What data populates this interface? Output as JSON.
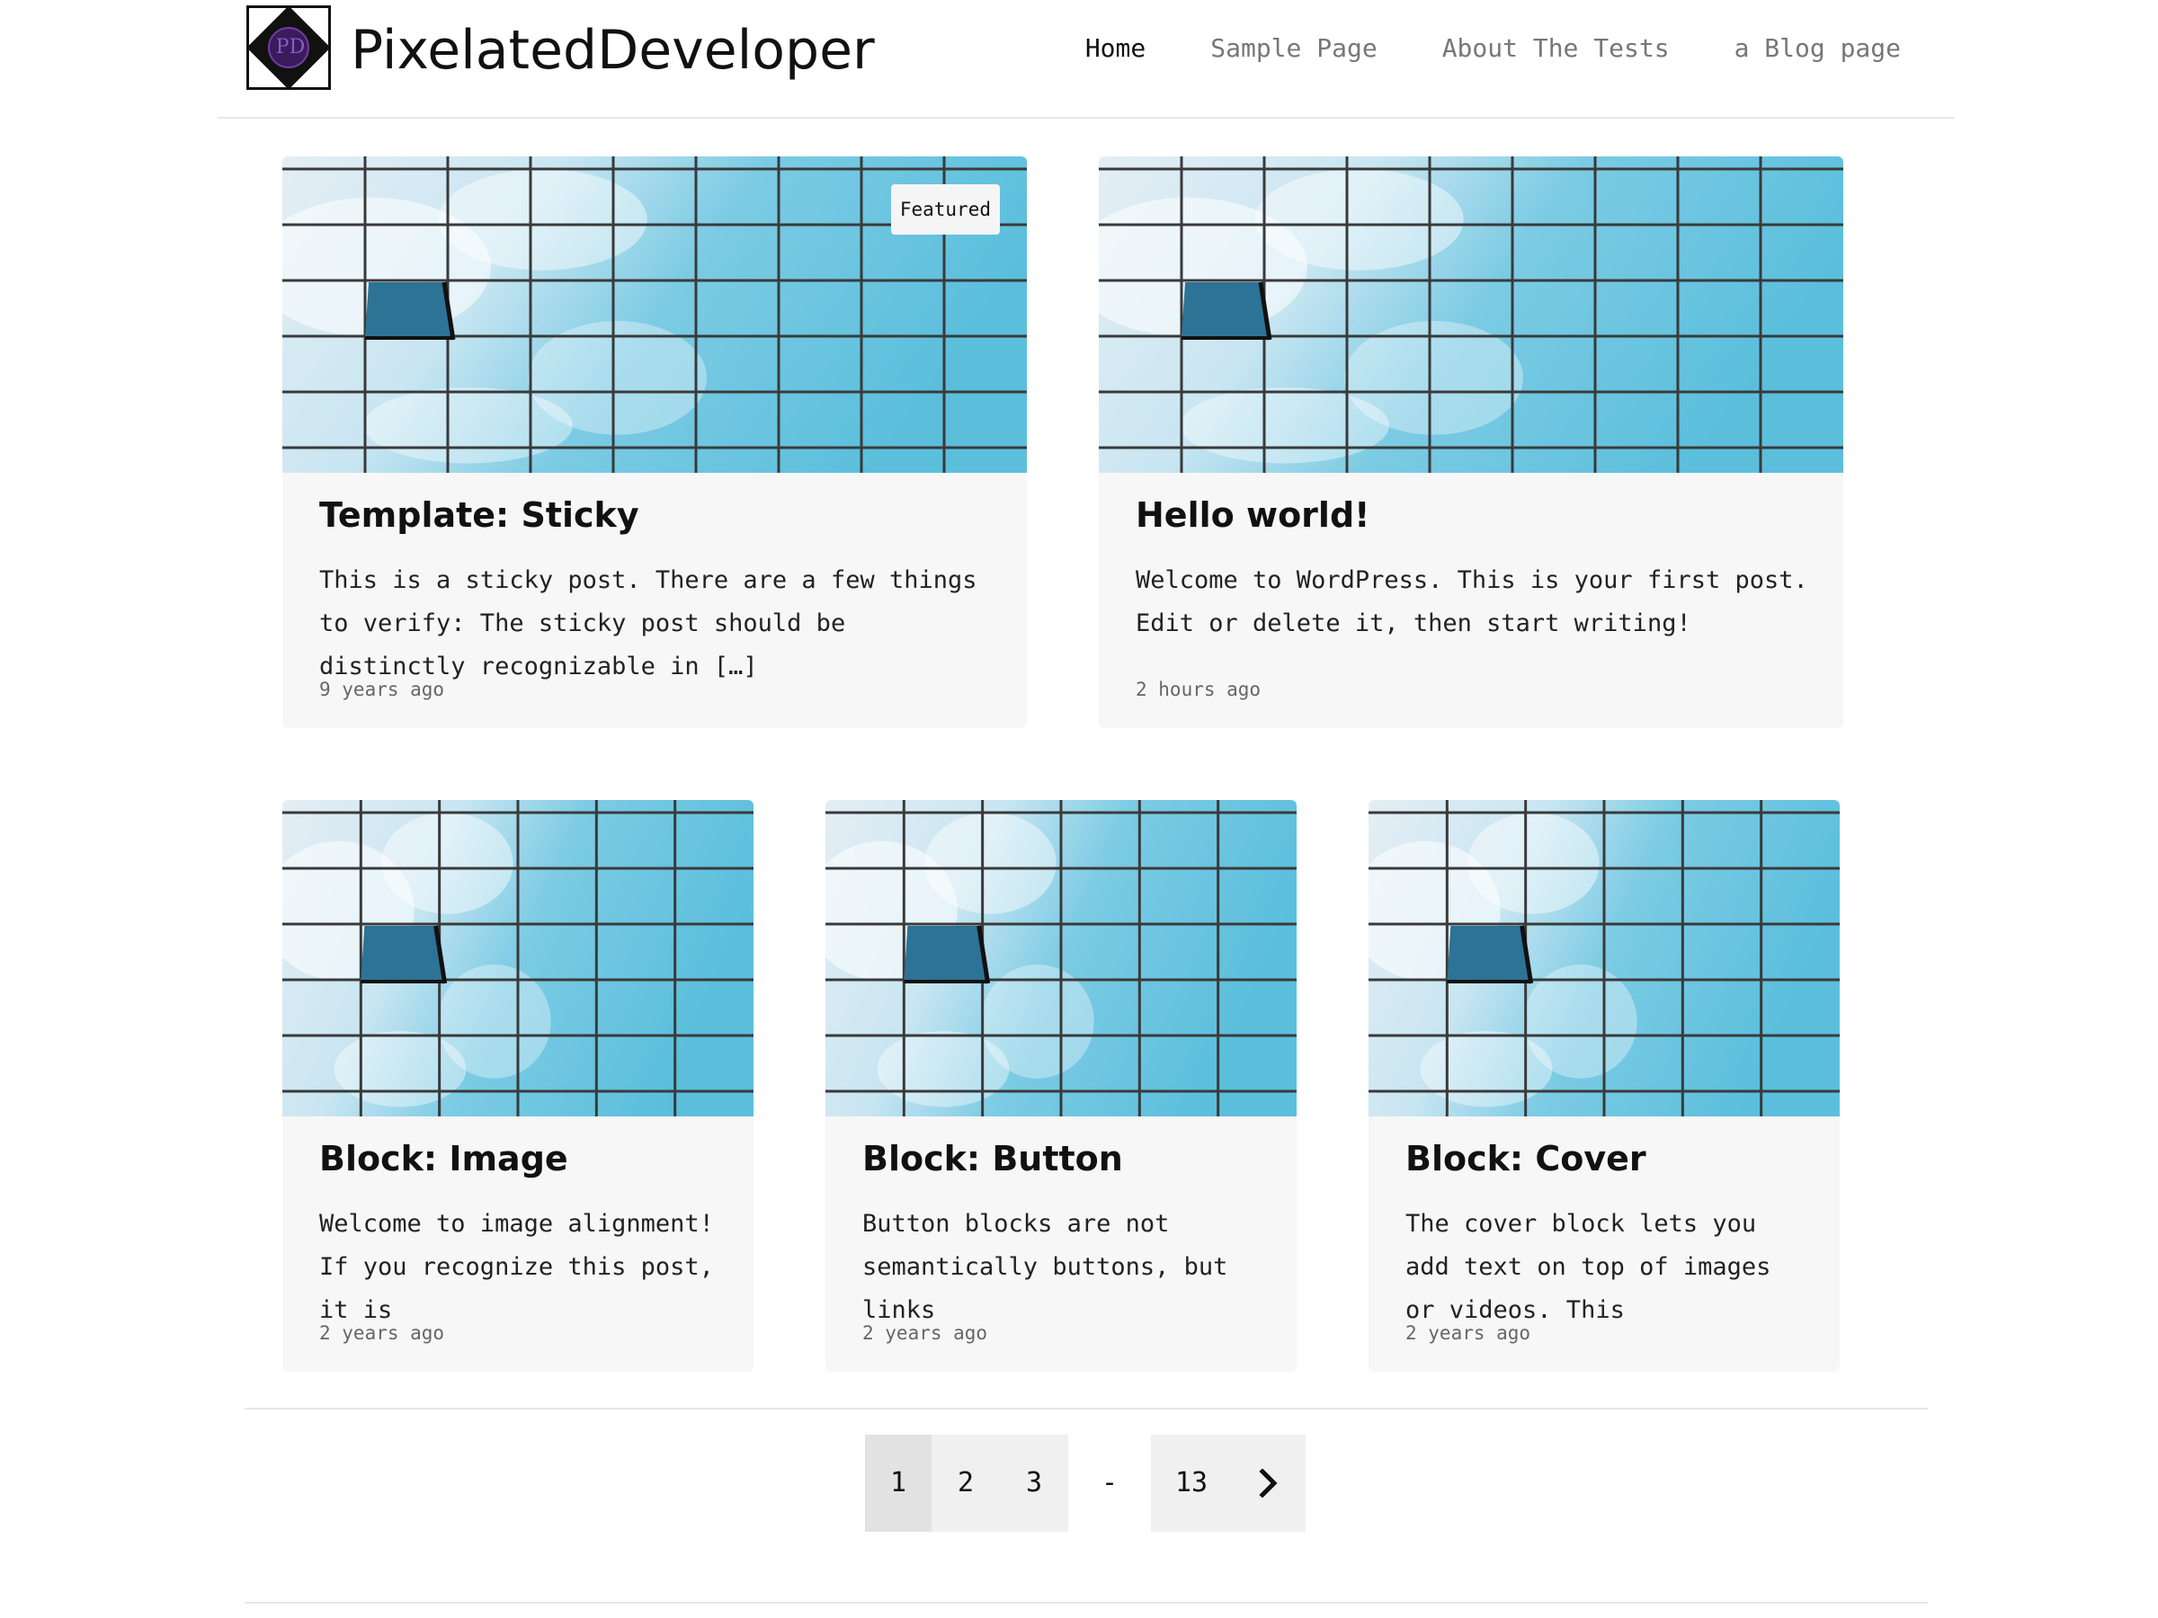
{
  "site": {
    "logo_text": "PD",
    "title": "PixelatedDeveloper"
  },
  "nav": {
    "items": [
      {
        "label": "Home",
        "active": true
      },
      {
        "label": "Sample Page",
        "active": false
      },
      {
        "label": "About The Tests",
        "active": false
      },
      {
        "label": "a Blog page",
        "active": false
      }
    ]
  },
  "posts": [
    {
      "title": "Template: Sticky",
      "excerpt": "This is a sticky post. There are a few things to verify: The sticky post should be distinctly recognizable in […]",
      "date": "9 years ago",
      "badge": "Featured"
    },
    {
      "title": "Hello world!",
      "excerpt": "Welcome to WordPress. This is your first post. Edit or delete it, then start writing!",
      "date": "2 hours ago"
    },
    {
      "title": "Block: Image",
      "excerpt": "Welcome to image alignment! If you recognize this post, it is",
      "date": "2 years ago"
    },
    {
      "title": "Block: Button",
      "excerpt": "Button blocks are not semantically buttons, but links",
      "date": "2 years ago"
    },
    {
      "title": "Block: Cover",
      "excerpt": "The cover block lets you add text on top of images or videos. This",
      "date": "2 years ago"
    }
  ],
  "pagination": {
    "pages": [
      "1",
      "2",
      "3"
    ],
    "separator": "-",
    "last": "13",
    "current": "1",
    "next_icon": "chevron-right-icon"
  },
  "colors": {
    "sky": "#5bbfdc",
    "grid_line": "#3a3a3a",
    "window": "#2d7396",
    "card_bg": "#f7f7f7"
  }
}
